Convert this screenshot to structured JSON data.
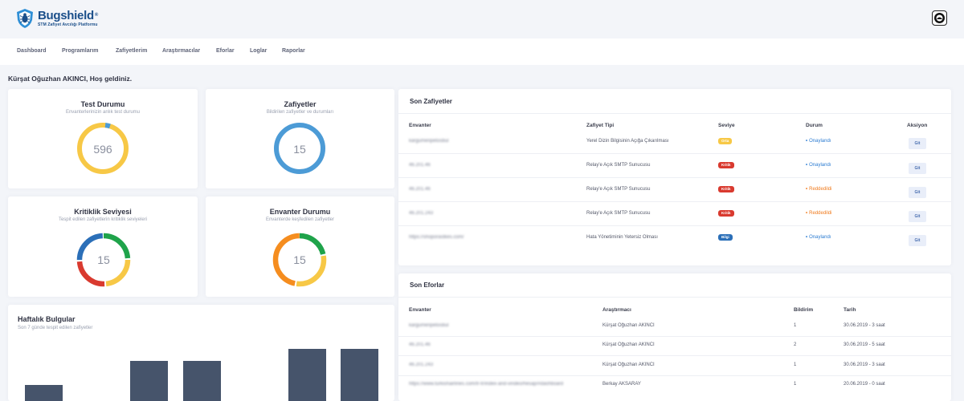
{
  "brand": {
    "name": "Bugshield",
    "trademark": "®",
    "tagline": "STM Zafiyet Avcılığı Platformu"
  },
  "nav": [
    "Dashboard",
    "Programlarım",
    "Zafiyetlerim",
    "Araştırmacılar",
    "Eforlar",
    "Loglar",
    "Raporlar"
  ],
  "welcome": "Kürşat Oğuzhan AKINCI, Hoş geldiniz.",
  "cards": {
    "test": {
      "title": "Test Durumu",
      "subtitle": "Envanterlerinizin anlık test durumu",
      "value": "596"
    },
    "vuln": {
      "title": "Zafiyetler",
      "subtitle": "Bildirilen zafiyetler ve durumları",
      "value": "15"
    },
    "crit": {
      "title": "Kritiklik Seviyesi",
      "subtitle": "Tespit edilen zafiyetlerin kritiklik seviyeleri",
      "value": "15"
    },
    "inv": {
      "title": "Envanter Durumu",
      "subtitle": "Envanterde keşfedilen zafiyetler",
      "value": "15"
    }
  },
  "colors": {
    "yellow": "#f7c846",
    "blue": "#4c9bd6",
    "green": "#1fa34a",
    "red": "#d93a2f",
    "orange": "#f58d1f",
    "bar": "#46546b"
  },
  "weekly": {
    "title": "Haftalık Bulgular",
    "subtitle": "Son 7 günde tespit edilen zafiyetler"
  },
  "son_zafiyetler": {
    "title": "Son Zafiyetler",
    "headers": [
      "Envanter",
      "Zafiyet Tipi",
      "Seviye",
      "Durum",
      "Aksiyon"
    ],
    "rows": [
      {
        "inventory": "kargumenpetosbul",
        "type": "Yerel Dizin Bilgisinin Açığa Çıkarılması",
        "level": "Orta",
        "level_color": "#f7c846",
        "status": "Onaylandı",
        "status_color": "#2b7bd1",
        "action": "Git"
      },
      {
        "inventory": "46.201.46",
        "type": "Relay'e Açık SMTP Sunucusu",
        "level": "Kritik",
        "level_color": "#d93a2f",
        "status": "Onaylandı",
        "status_color": "#2b7bd1",
        "action": "Git"
      },
      {
        "inventory": "46.201.46",
        "type": "Relay'e Açık SMTP Sunucusu",
        "level": "Kritik",
        "level_color": "#d93a2f",
        "status": "Reddedildi",
        "status_color": "#f07a1c",
        "action": "Git"
      },
      {
        "inventory": "46.201.243",
        "type": "Relay'e Açık SMTP Sunucusu",
        "level": "Kritik",
        "level_color": "#d93a2f",
        "status": "Reddedildi",
        "status_color": "#f07a1c",
        "action": "Git"
      },
      {
        "inventory": "https://shoporastkes.com/",
        "type": "Hata Yönetiminin Yetersiz Olması",
        "level": "Bilgi",
        "level_color": "#2b6fb8",
        "status": "Onaylandı",
        "status_color": "#2b7bd1",
        "action": "Git"
      }
    ]
  },
  "son_eforlar": {
    "title": "Son Eforlar",
    "headers": [
      "Envanter",
      "Araştırmacı",
      "Bildirim",
      "Tarih"
    ],
    "rows": [
      {
        "inventory": "kargumenpetosbul",
        "researcher": "Kürşat Oğuzhan AKINCI",
        "count": "1",
        "date": "30.06.2019 - 3 saat"
      },
      {
        "inventory": "46.201.46",
        "researcher": "Kürşat Oğuzhan AKINCI",
        "count": "2",
        "date": "30.06.2019 - 5 saat"
      },
      {
        "inventory": "46.201.243",
        "researcher": "Kürşat Oğuzhan AKINCI",
        "count": "1",
        "date": "30.06.2019 - 3 saat"
      },
      {
        "inventory": "https://www.turkishairlines.com/tr-tr/index-and-vindeo/hesap/#dashboard",
        "researcher": "Berkay AKSARAY",
        "count": "1",
        "date": "20.06.2019 - 0 saat"
      }
    ]
  }
}
